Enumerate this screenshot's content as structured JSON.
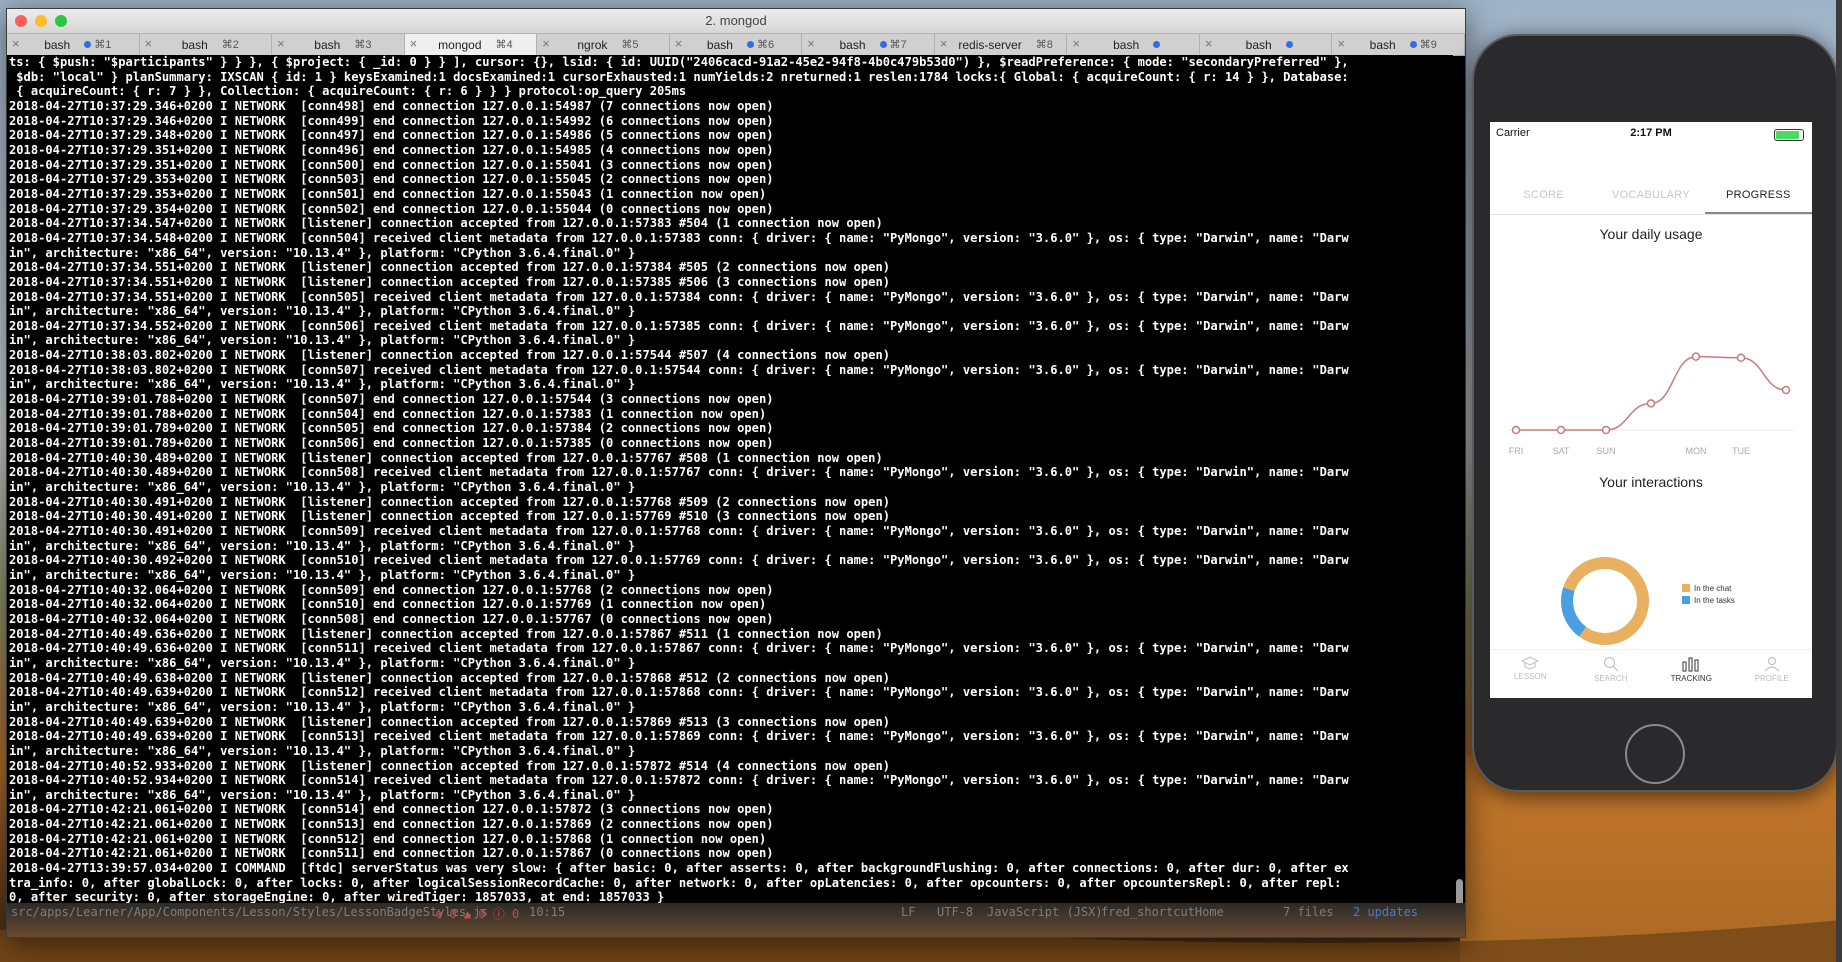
{
  "terminal": {
    "title": "2. mongod",
    "tabs": [
      {
        "name": "bash",
        "shortcut": "⌘1",
        "dot": true
      },
      {
        "name": "bash",
        "shortcut": "⌘2",
        "dot": false
      },
      {
        "name": "bash",
        "shortcut": "⌘3",
        "dot": false
      },
      {
        "name": "mongod",
        "shortcut": "⌘4",
        "dot": false,
        "active": true
      },
      {
        "name": "ngrok",
        "shortcut": "⌘5",
        "dot": false
      },
      {
        "name": "bash",
        "shortcut": "⌘6",
        "dot": true
      },
      {
        "name": "bash",
        "shortcut": "⌘7",
        "dot": true
      },
      {
        "name": "redis-server",
        "shortcut": "⌘8",
        "dot": false
      },
      {
        "name": "bash",
        "shortcut": "",
        "dot": true
      },
      {
        "name": "bash",
        "shortcut": "",
        "dot": true
      },
      {
        "name": "bash",
        "shortcut": "⌘9",
        "dot": true
      }
    ],
    "lines": [
      "ts: { $push: \"$participants\" } } }, { $project: { _id: 0 } } ], cursor: {}, lsid: { id: UUID(\"2406cacd-91a2-45e2-94f8-4b0c479b53d0\") }, $readPreference: { mode: \"secondaryPreferred\" },",
      " $db: \"local\" } planSummary: IXSCAN { id: 1 } keysExamined:1 docsExamined:1 cursorExhausted:1 numYields:2 nreturned:1 reslen:1784 locks:{ Global: { acquireCount: { r: 14 } }, Database:",
      " { acquireCount: { r: 7 } }, Collection: { acquireCount: { r: 6 } } } protocol:op_query 205ms",
      "2018-04-27T10:37:29.346+0200 I NETWORK  [conn498] end connection 127.0.0.1:54987 (7 connections now open)",
      "2018-04-27T10:37:29.346+0200 I NETWORK  [conn499] end connection 127.0.0.1:54992 (6 connections now open)",
      "2018-04-27T10:37:29.348+0200 I NETWORK  [conn497] end connection 127.0.0.1:54986 (5 connections now open)",
      "2018-04-27T10:37:29.351+0200 I NETWORK  [conn496] end connection 127.0.0.1:54985 (4 connections now open)",
      "2018-04-27T10:37:29.351+0200 I NETWORK  [conn500] end connection 127.0.0.1:55041 (3 connections now open)",
      "2018-04-27T10:37:29.353+0200 I NETWORK  [conn503] end connection 127.0.0.1:55045 (2 connections now open)",
      "2018-04-27T10:37:29.353+0200 I NETWORK  [conn501] end connection 127.0.0.1:55043 (1 connection now open)",
      "2018-04-27T10:37:29.354+0200 I NETWORK  [conn502] end connection 127.0.0.1:55044 (0 connections now open)",
      "2018-04-27T10:37:34.547+0200 I NETWORK  [listener] connection accepted from 127.0.0.1:57383 #504 (1 connection now open)",
      "2018-04-27T10:37:34.548+0200 I NETWORK  [conn504] received client metadata from 127.0.0.1:57383 conn: { driver: { name: \"PyMongo\", version: \"3.6.0\" }, os: { type: \"Darwin\", name: \"Darw",
      "in\", architecture: \"x86_64\", version: \"10.13.4\" }, platform: \"CPython 3.6.4.final.0\" }",
      "2018-04-27T10:37:34.551+0200 I NETWORK  [listener] connection accepted from 127.0.0.1:57384 #505 (2 connections now open)",
      "2018-04-27T10:37:34.551+0200 I NETWORK  [listener] connection accepted from 127.0.0.1:57385 #506 (3 connections now open)",
      "2018-04-27T10:37:34.551+0200 I NETWORK  [conn505] received client metadata from 127.0.0.1:57384 conn: { driver: { name: \"PyMongo\", version: \"3.6.0\" }, os: { type: \"Darwin\", name: \"Darw",
      "in\", architecture: \"x86_64\", version: \"10.13.4\" }, platform: \"CPython 3.6.4.final.0\" }",
      "2018-04-27T10:37:34.552+0200 I NETWORK  [conn506] received client metadata from 127.0.0.1:57385 conn: { driver: { name: \"PyMongo\", version: \"3.6.0\" }, os: { type: \"Darwin\", name: \"Darw",
      "in\", architecture: \"x86_64\", version: \"10.13.4\" }, platform: \"CPython 3.6.4.final.0\" }",
      "2018-04-27T10:38:03.802+0200 I NETWORK  [listener] connection accepted from 127.0.0.1:57544 #507 (4 connections now open)",
      "2018-04-27T10:38:03.802+0200 I NETWORK  [conn507] received client metadata from 127.0.0.1:57544 conn: { driver: { name: \"PyMongo\", version: \"3.6.0\" }, os: { type: \"Darwin\", name: \"Darw",
      "in\", architecture: \"x86_64\", version: \"10.13.4\" }, platform: \"CPython 3.6.4.final.0\" }",
      "2018-04-27T10:39:01.788+0200 I NETWORK  [conn507] end connection 127.0.0.1:57544 (3 connections now open)",
      "2018-04-27T10:39:01.788+0200 I NETWORK  [conn504] end connection 127.0.0.1:57383 (1 connection now open)",
      "2018-04-27T10:39:01.789+0200 I NETWORK  [conn505] end connection 127.0.0.1:57384 (2 connections now open)",
      "2018-04-27T10:39:01.789+0200 I NETWORK  [conn506] end connection 127.0.0.1:57385 (0 connections now open)",
      "2018-04-27T10:40:30.489+0200 I NETWORK  [listener] connection accepted from 127.0.0.1:57767 #508 (1 connection now open)",
      "2018-04-27T10:40:30.489+0200 I NETWORK  [conn508] received client metadata from 127.0.0.1:57767 conn: { driver: { name: \"PyMongo\", version: \"3.6.0\" }, os: { type: \"Darwin\", name: \"Darw",
      "in\", architecture: \"x86_64\", version: \"10.13.4\" }, platform: \"CPython 3.6.4.final.0\" }",
      "2018-04-27T10:40:30.491+0200 I NETWORK  [listener] connection accepted from 127.0.0.1:57768 #509 (2 connections now open)",
      "2018-04-27T10:40:30.491+0200 I NETWORK  [listener] connection accepted from 127.0.0.1:57769 #510 (3 connections now open)",
      "2018-04-27T10:40:30.491+0200 I NETWORK  [conn509] received client metadata from 127.0.0.1:57768 conn: { driver: { name: \"PyMongo\", version: \"3.6.0\" }, os: { type: \"Darwin\", name: \"Darw",
      "in\", architecture: \"x86_64\", version: \"10.13.4\" }, platform: \"CPython 3.6.4.final.0\" }",
      "2018-04-27T10:40:30.492+0200 I NETWORK  [conn510] received client metadata from 127.0.0.1:57769 conn: { driver: { name: \"PyMongo\", version: \"3.6.0\" }, os: { type: \"Darwin\", name: \"Darw",
      "in\", architecture: \"x86_64\", version: \"10.13.4\" }, platform: \"CPython 3.6.4.final.0\" }",
      "2018-04-27T10:40:32.064+0200 I NETWORK  [conn509] end connection 127.0.0.1:57768 (2 connections now open)",
      "2018-04-27T10:40:32.064+0200 I NETWORK  [conn510] end connection 127.0.0.1:57769 (1 connection now open)",
      "2018-04-27T10:40:32.064+0200 I NETWORK  [conn508] end connection 127.0.0.1:57767 (0 connections now open)",
      "2018-04-27T10:40:49.636+0200 I NETWORK  [listener] connection accepted from 127.0.0.1:57867 #511 (1 connection now open)",
      "2018-04-27T10:40:49.636+0200 I NETWORK  [conn511] received client metadata from 127.0.0.1:57867 conn: { driver: { name: \"PyMongo\", version: \"3.6.0\" }, os: { type: \"Darwin\", name: \"Darw",
      "in\", architecture: \"x86_64\", version: \"10.13.4\" }, platform: \"CPython 3.6.4.final.0\" }",
      "2018-04-27T10:40:49.638+0200 I NETWORK  [listener] connection accepted from 127.0.0.1:57868 #512 (2 connections now open)",
      "2018-04-27T10:40:49.639+0200 I NETWORK  [conn512] received client metadata from 127.0.0.1:57868 conn: { driver: { name: \"PyMongo\", version: \"3.6.0\" }, os: { type: \"Darwin\", name: \"Darw",
      "in\", architecture: \"x86_64\", version: \"10.13.4\" }, platform: \"CPython 3.6.4.final.0\" }",
      "2018-04-27T10:40:49.639+0200 I NETWORK  [listener] connection accepted from 127.0.0.1:57869 #513 (3 connections now open)",
      "2018-04-27T10:40:49.639+0200 I NETWORK  [conn513] received client metadata from 127.0.0.1:57869 conn: { driver: { name: \"PyMongo\", version: \"3.6.0\" }, os: { type: \"Darwin\", name: \"Darw",
      "in\", architecture: \"x86_64\", version: \"10.13.4\" }, platform: \"CPython 3.6.4.final.0\" }",
      "2018-04-27T10:40:52.933+0200 I NETWORK  [listener] connection accepted from 127.0.0.1:57872 #514 (4 connections now open)",
      "2018-04-27T10:40:52.934+0200 I NETWORK  [conn514] received client metadata from 127.0.0.1:57872 conn: { driver: { name: \"PyMongo\", version: \"3.6.0\" }, os: { type: \"Darwin\", name: \"Darw",
      "in\", architecture: \"x86_64\", version: \"10.13.4\" }, platform: \"CPython 3.6.4.final.0\" }",
      "2018-04-27T10:42:21.061+0200 I NETWORK  [conn514] end connection 127.0.0.1:57872 (3 connections now open)",
      "2018-04-27T10:42:21.061+0200 I NETWORK  [conn513] end connection 127.0.0.1:57869 (2 connections now open)",
      "2018-04-27T10:42:21.061+0200 I NETWORK  [conn512] end connection 127.0.0.1:57868 (1 connection now open)",
      "2018-04-27T10:42:21.061+0200 I NETWORK  [conn511] end connection 127.0.0.1:57867 (0 connections now open)",
      "2018-04-27T13:39:57.034+0200 I COMMAND  [ftdc] serverStatus was very slow: { after basic: 0, after asserts: 0, after backgroundFlushing: 0, after connections: 0, after dur: 0, after ex",
      "tra_info: 0, after globalLock: 0, after locks: 0, after logicalSessionRecordCache: 0, after network: 0, after opLatencies: 0, after opcounters: 0, after opcountersRepl: 0, after repl:",
      "0, after security: 0, after storageEngine: 0, after wiredTiger: 1857033, at end: 1857033 }"
    ],
    "editor_status": {
      "path": "src/apps/Learner/App/Components/Lesson/Styles/LessonBadgeStyles.js",
      "problems": "⊗ 0 ▲ 0 ⓘ 0",
      "position": "10:15",
      "line_ending": "LF",
      "encoding": "UTF-8",
      "grammar": "JavaScript (JSX)",
      "branch": "fred_shortcutHome",
      "files": "7 files",
      "updates": "2 updates"
    }
  },
  "phone": {
    "status": {
      "carrier": "Carrier",
      "time": "2:17 PM"
    },
    "tabs": [
      {
        "label": "SCORE",
        "active": false
      },
      {
        "label": "VOCABULARY",
        "active": false
      },
      {
        "label": "PROGRESS",
        "active": true
      }
    ],
    "daily_usage_title": "Your daily usage",
    "interactions_title": "Your interactions",
    "legend": [
      {
        "label": "In the chat",
        "color": "#e8b060"
      },
      {
        "label": "In the tasks",
        "color": "#4a9fe0"
      }
    ],
    "bottom_nav": [
      {
        "label": "LESSON",
        "icon": "graduation-cap-icon",
        "active": false
      },
      {
        "label": "SEARCH",
        "icon": "search-icon",
        "active": false
      },
      {
        "label": "TRACKING",
        "icon": "bar-chart-icon",
        "active": true
      },
      {
        "label": "PROFILE",
        "icon": "person-icon",
        "active": false
      }
    ],
    "colors": {
      "line": "#c97a7a",
      "chat": "#e8b060",
      "tasks": "#4a9fe0"
    }
  },
  "chart_data": [
    {
      "type": "line",
      "title": "Your daily usage",
      "categories": [
        "FRI",
        "SAT",
        "SUN",
        "MON",
        "TUE"
      ],
      "points_x": [
        "FRI",
        "SAT",
        "SUN",
        "",
        "MON",
        "TUE",
        ""
      ],
      "values": [
        0,
        0,
        0,
        1.2,
        3.3,
        3.25,
        1.8
      ],
      "ylim": [
        0,
        3.6
      ],
      "grid": false
    },
    {
      "type": "pie",
      "title": "Your interactions",
      "labels": [
        "In the chat",
        "In the tasks"
      ],
      "values": [
        80,
        20
      ],
      "donut": true
    }
  ]
}
